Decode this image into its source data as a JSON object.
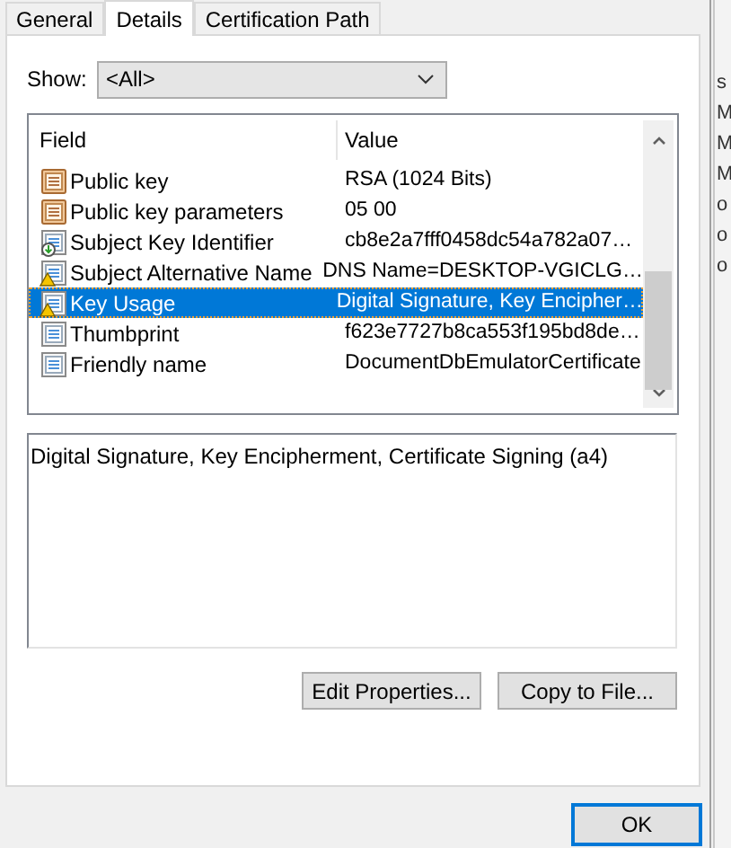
{
  "tabs": [
    {
      "label": "General",
      "selected": false
    },
    {
      "label": "Details",
      "selected": true
    },
    {
      "label": "Certification Path",
      "selected": false
    }
  ],
  "show": {
    "label": "Show:",
    "value": "<All>"
  },
  "table": {
    "columns": [
      "Field",
      "Value"
    ],
    "rows": [
      {
        "kind": "plain",
        "field": "Public key",
        "value": "RSA (1024 Bits)",
        "selected": false
      },
      {
        "kind": "plain",
        "field": "Public key parameters",
        "value": "05 00",
        "selected": false
      },
      {
        "kind": "download",
        "field": "Subject Key Identifier",
        "value": "cb8e2a7fff0458dc54a782a07…",
        "selected": false
      },
      {
        "kind": "warning",
        "field": "Subject Alternative Name",
        "value": "DNS Name=DESKTOP-VGICLG…",
        "selected": false
      },
      {
        "kind": "warning",
        "field": "Key Usage",
        "value": "Digital Signature, Key Encipher…",
        "selected": true
      },
      {
        "kind": "extension",
        "field": "Thumbprint",
        "value": "f623e7727b8ca553f195bd8de…",
        "selected": false
      },
      {
        "kind": "extension",
        "field": "Friendly name",
        "value": "DocumentDbEmulatorCertificate",
        "selected": false
      }
    ]
  },
  "detail_text": "Digital Signature, Key Encipherment, Certificate Signing (a4)",
  "buttons": [
    "Edit Properties...",
    "Copy to File..."
  ],
  "ok_button": "OK",
  "background_window": [
    "s",
    "M",
    "M",
    "M",
    "o",
    "o",
    "o"
  ]
}
